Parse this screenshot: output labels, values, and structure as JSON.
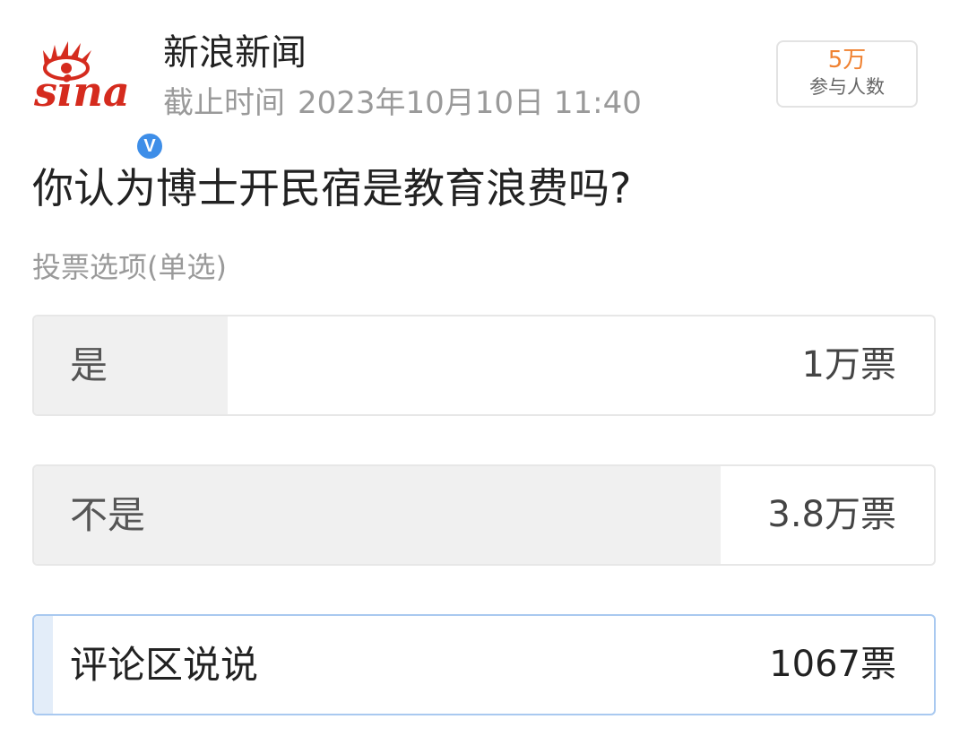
{
  "publisher": {
    "name": "新浪新闻",
    "logo_text": "sina",
    "logo_icon": "sina-eye-logo",
    "verified_icon": "verified-v-badge",
    "verified_mark": "V"
  },
  "deadline": {
    "label": "截止时间",
    "datetime": "2023年10月10日 11:40"
  },
  "participants": {
    "count": "5万",
    "label": "参与人数"
  },
  "poll": {
    "question": "你认为博士开民宿是教育浪费吗?",
    "vote_type": "投票选项(单选)",
    "options": [
      {
        "label": "是",
        "votes": "1万票",
        "share": 0.215,
        "selected": false
      },
      {
        "label": "不是",
        "votes": "3.8万票",
        "share": 0.763,
        "selected": false
      },
      {
        "label": "评论区说说",
        "votes": "1067票",
        "share": 0.021,
        "selected": true
      }
    ]
  },
  "colors": {
    "accent_orange": "#f08232",
    "verified_blue": "#3e8ee8",
    "selected_border": "#a9c9f0",
    "bar_fill": "#f0f0f0",
    "selected_fill": "#e3edf9",
    "logo_red": "#d52b1e"
  }
}
